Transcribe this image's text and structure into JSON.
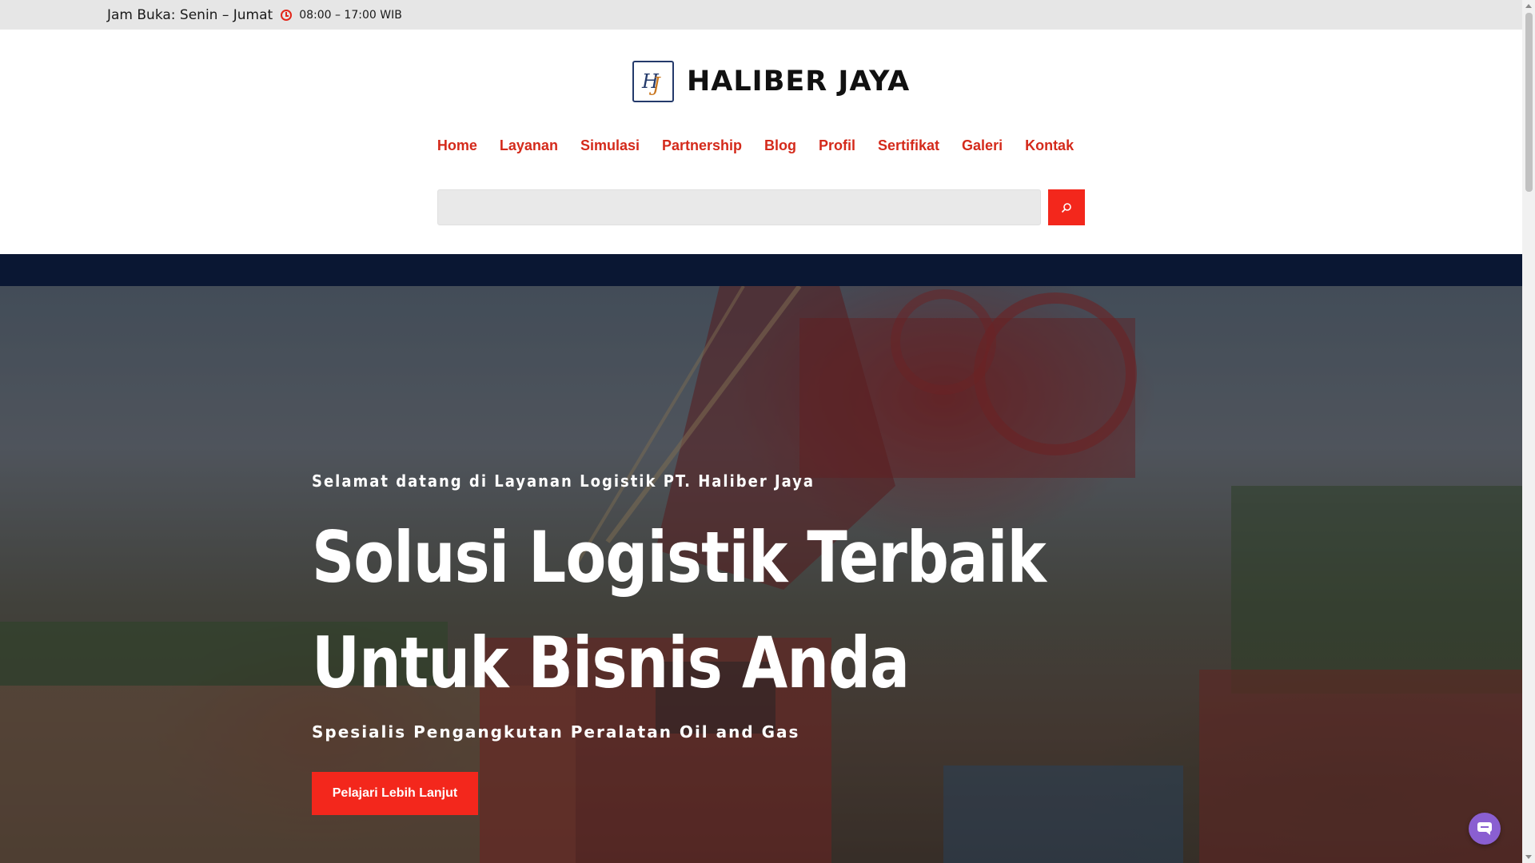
{
  "topbar": {
    "hours_label": "Jam Buka: Senin – Jumat",
    "hours_time": "08:00 – 17:00 WIB",
    "clock_icon": "clock-icon"
  },
  "brand": {
    "name": "HALIBER JAYA",
    "logo_initials": "HJ"
  },
  "nav": {
    "items": [
      {
        "label": "Home"
      },
      {
        "label": "Layanan"
      },
      {
        "label": "Simulasi"
      },
      {
        "label": "Partnership"
      },
      {
        "label": "Blog"
      },
      {
        "label": "Profil"
      },
      {
        "label": "Sertifikat"
      },
      {
        "label": "Galeri"
      },
      {
        "label": "Kontak"
      }
    ]
  },
  "search": {
    "placeholder": "",
    "value": "",
    "button_icon": "search-icon"
  },
  "hero": {
    "kicker": "Selamat datang di Layanan Logistik PT. Haliber Jaya",
    "title": "Solusi Logistik Terbaik Untuk Bisnis Anda",
    "subtitle": "Spesialis Pengangkutan Peralatan Oil and Gas",
    "cta_label": "Pelajari Lebih Lanjut"
  },
  "chat": {
    "icon": "chat-icon"
  },
  "colors": {
    "accent": "#f3271c",
    "nav_text": "#d42a1b",
    "dark_strip": "#0a1733",
    "topbar_bg": "#e6e6e6"
  }
}
